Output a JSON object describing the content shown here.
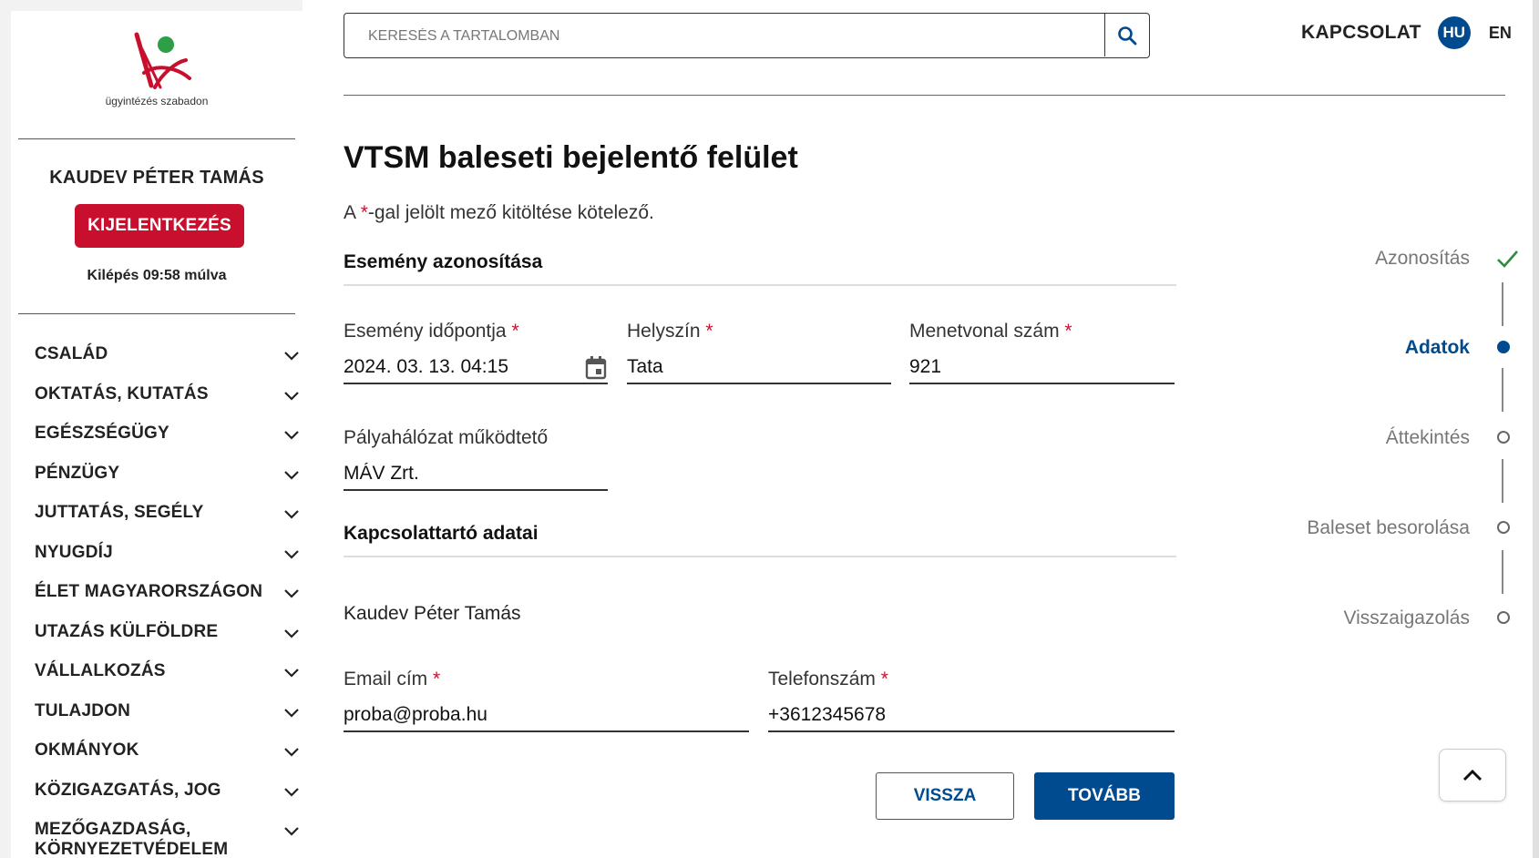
{
  "sidebar": {
    "logo_text": "ügyintézés szabadon",
    "user_name": "KAUDEV PÉTER TAMÁS",
    "logout_label": "KIJELENTKEZÉS",
    "timer_text": "Kilépés 09:58 múlva",
    "nav": [
      {
        "label": "CSALÁD"
      },
      {
        "label": "OKTATÁS, KUTATÁS"
      },
      {
        "label": "EGÉSZSÉGÜGY"
      },
      {
        "label": "PÉNZÜGY"
      },
      {
        "label": "JUTTATÁS, SEGÉLY"
      },
      {
        "label": "NYUGDÍJ"
      },
      {
        "label": "ÉLET MAGYARORSZÁGON"
      },
      {
        "label": "UTAZÁS KÜLFÖLDRE"
      },
      {
        "label": "VÁLLALKOZÁS"
      },
      {
        "label": "TULAJDON"
      },
      {
        "label": "OKMÁNYOK"
      },
      {
        "label": "KÖZIGAZGATÁS, JOG"
      },
      {
        "label": "MEZŐGAZDASÁG, KÖRNYEZETVÉDELEM"
      }
    ]
  },
  "header": {
    "search_placeholder": "KERESÉS A TARTALOMBAN",
    "contact_label": "KAPCSOLAT",
    "lang_active": "HU",
    "lang_other": "EN"
  },
  "page": {
    "title": "VTSM baleseti bejelentő felület",
    "required_note_pre": "A ",
    "required_star": "*",
    "required_note_post": "-gal jelölt mező kitöltése kötelező.",
    "section1_title": "Esemény azonosítása",
    "section2_title": "Kapcsolattartó adatai",
    "fields": {
      "event_time": {
        "label": "Esemény időpontja",
        "value": "2024. 03. 13. 04:15"
      },
      "location": {
        "label": "Helyszín",
        "value": "Tata"
      },
      "route_number": {
        "label": "Menetvonal szám",
        "value": "921"
      },
      "operator": {
        "label": "Pályahálózat működtető",
        "value": "MÁV Zrt."
      },
      "email": {
        "label": "Email cím",
        "value": "proba@proba.hu"
      },
      "phone": {
        "label": "Telefonszám",
        "value": "+3612345678"
      }
    },
    "required_mark": "*",
    "contact_name": "Kaudev Péter Tamás",
    "back_label": "VISSZA",
    "next_label": "TOVÁBB"
  },
  "stepper": {
    "steps": [
      {
        "label": "Azonosítás",
        "state": "done"
      },
      {
        "label": "Adatok",
        "state": "active"
      },
      {
        "label": "Áttekintés",
        "state": "pending"
      },
      {
        "label": "Baleset besorolása",
        "state": "pending"
      },
      {
        "label": "Visszaigazolás",
        "state": "pending"
      }
    ]
  },
  "colors": {
    "brand_red": "#c8102e",
    "brand_blue": "#004a8f",
    "logo_green": "#2e9e47",
    "check_green": "#2e8b3a"
  }
}
